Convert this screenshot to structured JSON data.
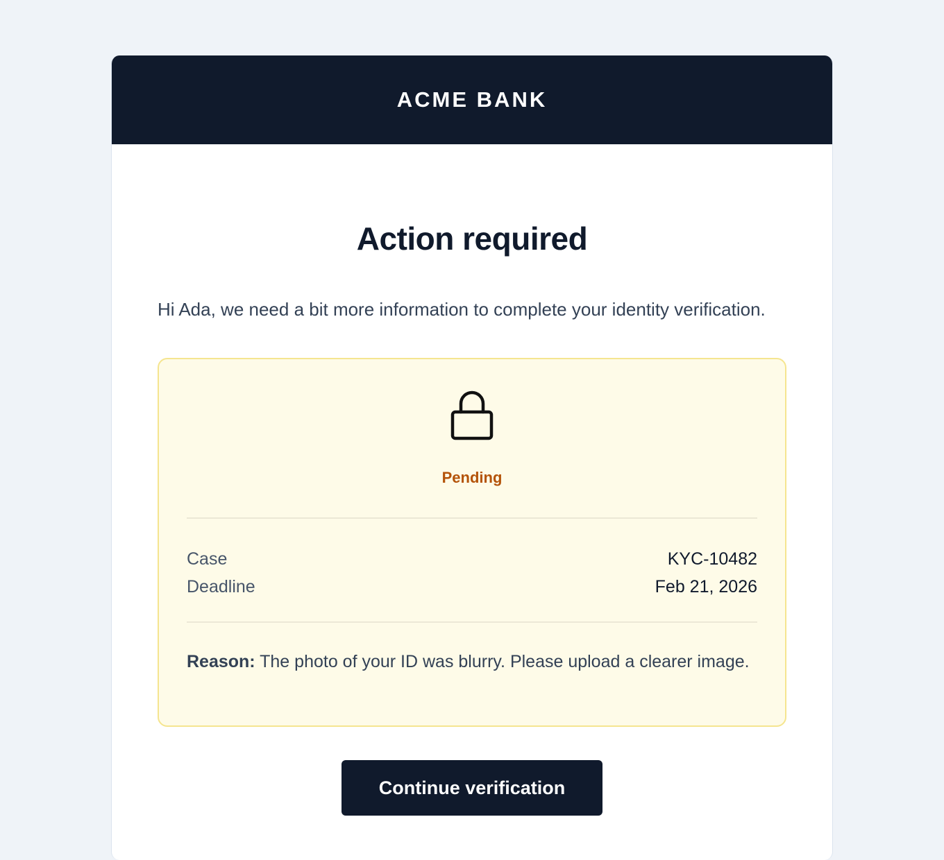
{
  "brand": {
    "name": "ACME BANK"
  },
  "message": {
    "title": "Action required",
    "intro": "Hi Ada, we need a bit more information to complete your identity verification."
  },
  "status": {
    "icon": "lock-icon",
    "label": "Pending",
    "color": "#b45309",
    "panel_background": "#fefbe8",
    "panel_border": "#f5e58f"
  },
  "details": [
    {
      "key": "Case",
      "value": "KYC-10482"
    },
    {
      "key": "Deadline",
      "value": "Feb 21, 2026"
    }
  ],
  "reason": {
    "label": "Reason:",
    "text": " The photo of your ID was blurry. Please upload a clearer image."
  },
  "cta": {
    "label": "Continue verification"
  },
  "colors": {
    "page_background": "#eff3f8",
    "header_background": "#101a2c",
    "button_background": "#101a2c"
  }
}
